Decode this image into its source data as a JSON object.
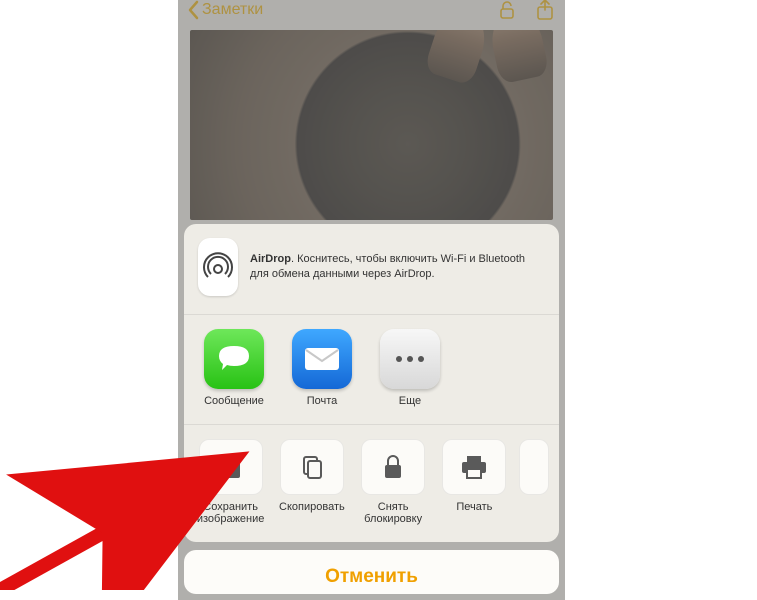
{
  "nav": {
    "back_label": "Заметки"
  },
  "airdrop": {
    "bold": "AirDrop",
    "text": ". Коснитесь, чтобы включить Wi-Fi и Bluetooth для обмена данными через AirDrop."
  },
  "apps": {
    "messages": "Сообщение",
    "mail": "Почта",
    "more": "Еще"
  },
  "actions": {
    "save_image": "Сохранить изображение",
    "copy": "Скопировать",
    "unlock": "Снять блокировку",
    "print": "Печать"
  },
  "cancel_label": "Отменить"
}
